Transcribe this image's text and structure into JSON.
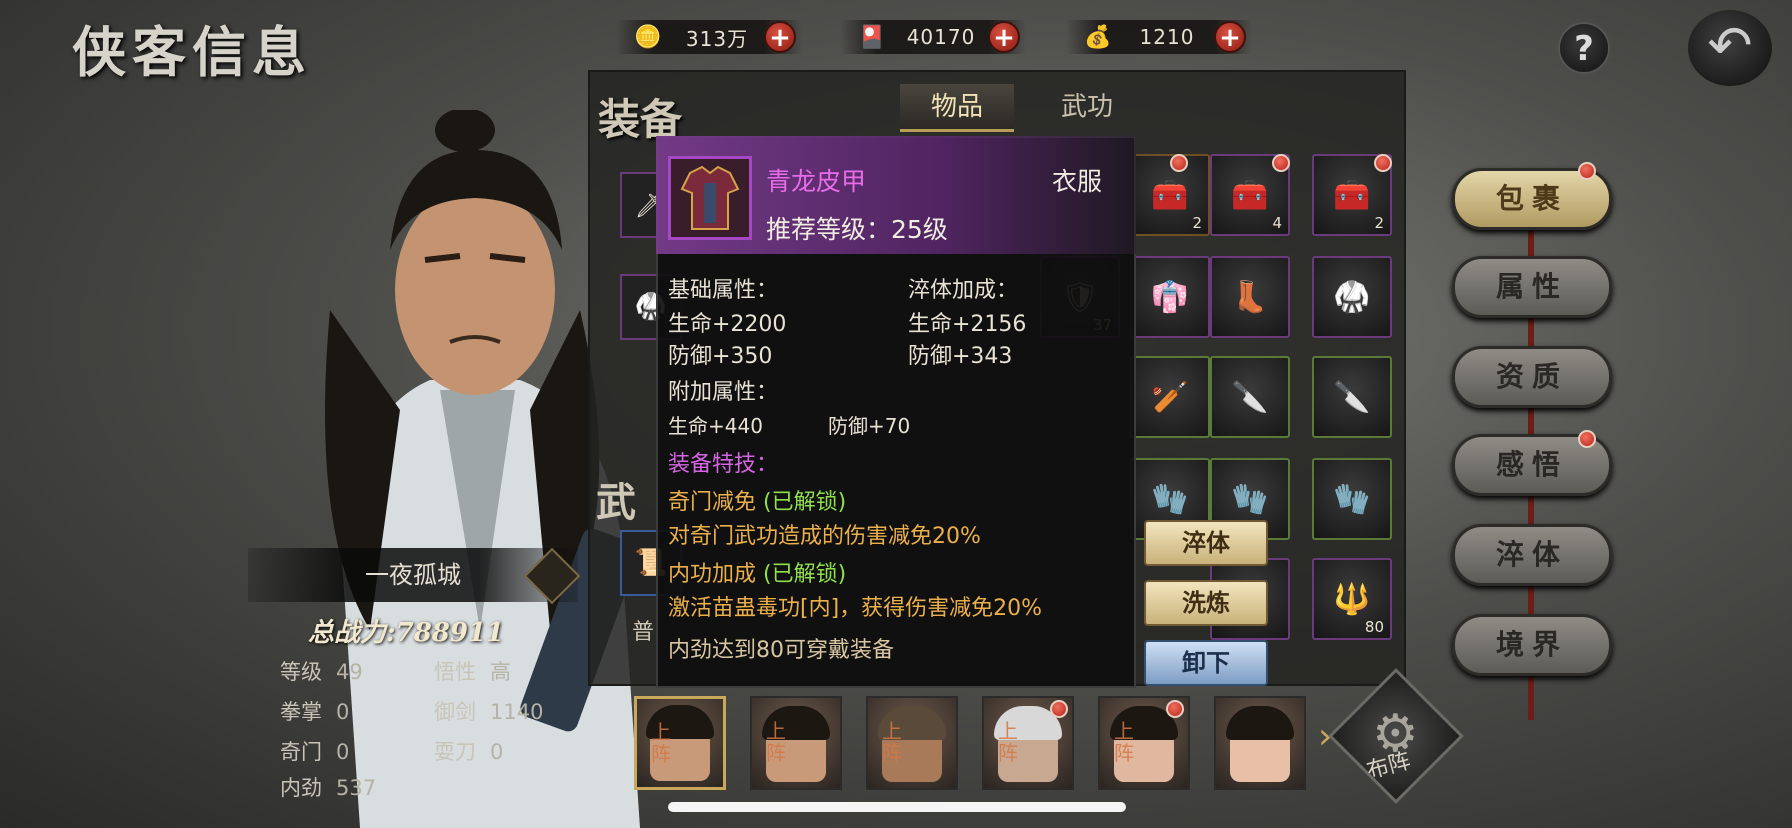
{
  "header": {
    "title": "侠客信息",
    "resources": [
      {
        "icon": "copper-coin-icon",
        "value": "313万"
      },
      {
        "icon": "token-card-icon",
        "value": "40170"
      },
      {
        "icon": "gold-ingot-icon",
        "value": "1210"
      }
    ],
    "help_label": "?"
  },
  "character": {
    "name": "一夜孤城",
    "combat_power": "总战力:788911",
    "stats": [
      {
        "label": "等级",
        "value": "49"
      },
      {
        "label": "悟性",
        "value": "高"
      },
      {
        "label": "拳掌",
        "value": "0"
      },
      {
        "label": "御剑",
        "value": "1140"
      },
      {
        "label": "奇门",
        "value": "0"
      },
      {
        "label": "耍刀",
        "value": "0"
      },
      {
        "label": "内劲",
        "value": "537"
      }
    ]
  },
  "panel": {
    "equip_label": "装备",
    "tabs": [
      "物品",
      "武功"
    ],
    "grid_counts": [
      "2",
      "4",
      "2",
      "37",
      "80"
    ],
    "left_fragments": {
      "martial": "武",
      "normal": "普"
    }
  },
  "side_menu": [
    "包裹",
    "属性",
    "资质",
    "感悟",
    "淬体",
    "境界"
  ],
  "tooltip": {
    "item_name": "青龙皮甲",
    "item_type": "衣服",
    "level_req": "推荐等级：25级",
    "base_title": "基础属性：",
    "base_stats": [
      "生命+2200",
      "防御+350"
    ],
    "temper_title": "淬体加成：",
    "temper_stats": [
      "生命+2156",
      "防御+343"
    ],
    "extra_title": "附加属性：",
    "extra_stats": [
      "生命+440",
      "防御+70"
    ],
    "skill_title": "装备特技：",
    "skills": [
      {
        "name": "奇门减免",
        "status": "(已解锁)",
        "desc": "对奇门武功造成的伤害减免20%"
      },
      {
        "name": "内功加成",
        "status": "(已解锁)",
        "desc": "激活苗蛊毒功[内]，获得伤害减免20%"
      }
    ],
    "requirement": "内劲达到80可穿戴装备",
    "buttons": {
      "temper": "淬体",
      "refine": "洗炼",
      "unequip": "卸下"
    }
  },
  "roster": {
    "tag": "上阵",
    "formation_label": "布阵"
  },
  "colors": {
    "accent_gold": "#c9a85c",
    "item_purple": "#e86be8",
    "skill_orange": "#ebb04b",
    "unlocked_green": "#8fe04c"
  }
}
